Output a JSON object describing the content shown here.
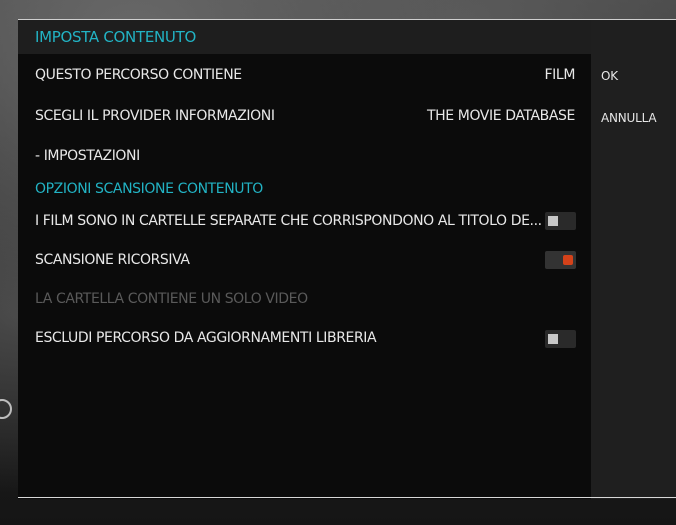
{
  "dialog": {
    "title": "IMPOSTA CONTENUTO",
    "rows": {
      "content_type": {
        "label": "QUESTO PERCORSO CONTIENE",
        "value": "FILM"
      },
      "provider": {
        "label": "SCEGLI IL PROVIDER INFORMAZIONI",
        "value": "THE MOVIE DATABASE"
      },
      "settings": {
        "label": "- IMPOSTAZIONI"
      }
    },
    "scan_options": {
      "heading": "OPZIONI SCANSIONE CONTENUTO",
      "separate_folders": {
        "label": "I FILM SONO IN CARTELLE SEPARATE CHE CORRISPONDONO AL TITOLO DE...",
        "enabled": false
      },
      "recursive_scan": {
        "label": "SCANSIONE RICORSIVA",
        "enabled": true
      },
      "single_video": {
        "label": "LA CARTELLA CONTIENE UN SOLO VIDEO",
        "disabled": true
      },
      "exclude_path": {
        "label": "ESCLUDI PERCORSO DA AGGIORNAMENTI LIBRERIA",
        "enabled": false
      }
    },
    "buttons": {
      "ok": "OK",
      "cancel": "ANNULLA"
    }
  },
  "colors": {
    "accent": "#22b3c4",
    "toggle_on": "#d4421a",
    "disabled_text": "#5a5a5a"
  }
}
